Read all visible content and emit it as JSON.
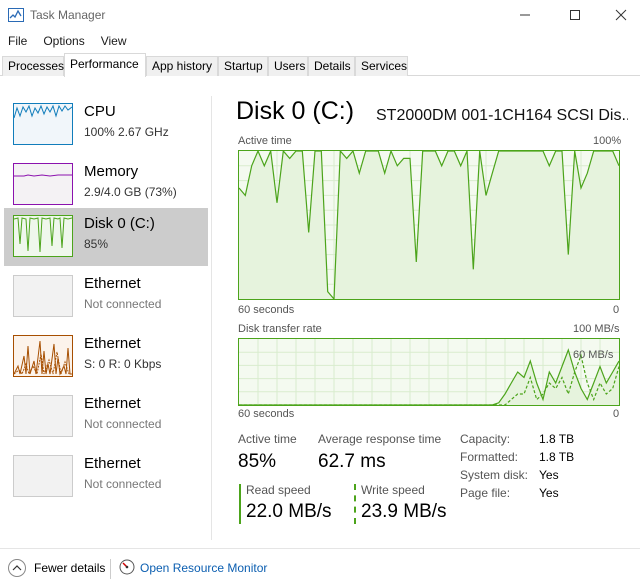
{
  "window": {
    "title": "Task Manager",
    "icon": "task-manager-icon"
  },
  "menu": [
    "File",
    "Options",
    "View"
  ],
  "tabs": [
    "Processes",
    "Performance",
    "App history",
    "Startup",
    "Users",
    "Details",
    "Services"
  ],
  "active_tab": "Performance",
  "sidebar": [
    {
      "title": "CPU",
      "subtitle": "100%  2.67 GHz",
      "color": "#117dbb",
      "bg": "#f1f6fa"
    },
    {
      "title": "Memory",
      "subtitle": "2.9/4.0 GB (73%)",
      "color": "#8b12ae",
      "bg": "#f4f2f4"
    },
    {
      "title": "Disk 0 (C:)",
      "subtitle": "85%",
      "color": "#4ca41b",
      "bg": "#eff7ec"
    },
    {
      "title": "Ethernet",
      "subtitle": "Not connected",
      "color": "#cccccc",
      "bg": "#f2f2f2"
    },
    {
      "title": "Ethernet",
      "subtitle": "S: 0  R: 0 Kbps",
      "color": "#a74f01",
      "bg": "#fcf3eb"
    },
    {
      "title": "Ethernet",
      "subtitle": "Not connected",
      "color": "#cccccc",
      "bg": "#f2f2f2"
    },
    {
      "title": "Ethernet",
      "subtitle": "Not connected",
      "color": "#cccccc",
      "bg": "#f2f2f2"
    }
  ],
  "selected_sidebar_index": 2,
  "disk": {
    "title": "Disk 0 (C:)",
    "model": "ST2000DM 001-1CH164 SCSI Dis...",
    "active_time_label": "Active time",
    "active_time_max": "100%",
    "active_time_graph_time": "60 seconds",
    "active_time_graph_min": "0",
    "transfer_rate_label": "Disk transfer rate",
    "transfer_rate_max": "100 MB/s",
    "transfer_rate_mid": "60 MB/s",
    "transfer_graph_time": "60 seconds",
    "transfer_graph_min": "0",
    "active_time_series": [
      75,
      70,
      90,
      100,
      90,
      100,
      65,
      100,
      95,
      100,
      100,
      45,
      100,
      100,
      5,
      0,
      100,
      95,
      100,
      85,
      100,
      100,
      100,
      85,
      100,
      90,
      95,
      95,
      25,
      100,
      100,
      100,
      90,
      100,
      100,
      90,
      100,
      20,
      100,
      70,
      85,
      100,
      100,
      100,
      100,
      100,
      100,
      100,
      100,
      90,
      100,
      100,
      30,
      100,
      75,
      85,
      100,
      100,
      100,
      100,
      90
    ],
    "read_series": [
      0,
      0,
      0,
      0,
      0,
      0,
      0,
      0,
      0,
      0,
      0,
      0,
      0,
      0,
      0,
      0,
      0,
      0,
      0,
      0,
      0,
      0,
      0,
      0,
      0,
      0,
      0,
      0,
      0,
      0,
      0,
      0,
      0,
      0,
      0,
      0,
      0,
      0,
      0,
      0,
      0,
      2,
      10,
      20,
      30,
      25,
      40,
      20,
      5,
      30,
      20,
      35,
      50,
      30,
      15,
      5,
      20,
      35,
      20,
      30,
      40
    ],
    "write_series": [
      0,
      0,
      0,
      0,
      0,
      0,
      0,
      0,
      0,
      0,
      0,
      0,
      0,
      0,
      0,
      0,
      0,
      0,
      0,
      0,
      0,
      0,
      0,
      0,
      0,
      0,
      0,
      0,
      0,
      0,
      0,
      0,
      0,
      0,
      0,
      0,
      0,
      0,
      0,
      0,
      0,
      0,
      0,
      5,
      10,
      10,
      25,
      5,
      10,
      20,
      15,
      25,
      10,
      30,
      45,
      20,
      5,
      20,
      10,
      15,
      35
    ]
  },
  "stats": {
    "active_time_label": "Active time",
    "active_time_value": "85%",
    "avg_response_label": "Average response time",
    "avg_response_value": "62.7 ms",
    "read_speed_label": "Read speed",
    "read_speed_value": "22.0 MB/s",
    "write_speed_label": "Write speed",
    "write_speed_value": "23.9 MB/s"
  },
  "info": [
    {
      "label": "Capacity:",
      "value": "1.8 TB"
    },
    {
      "label": "Formatted:",
      "value": "1.8 TB"
    },
    {
      "label": "System disk:",
      "value": "Yes"
    },
    {
      "label": "Page file:",
      "value": "Yes"
    }
  ],
  "footer": {
    "fewer_details": "Fewer details",
    "open_resource_monitor": "Open Resource Monitor"
  },
  "colors": {
    "disk_accent": "#4ca41b",
    "link": "#0b5eb0"
  }
}
